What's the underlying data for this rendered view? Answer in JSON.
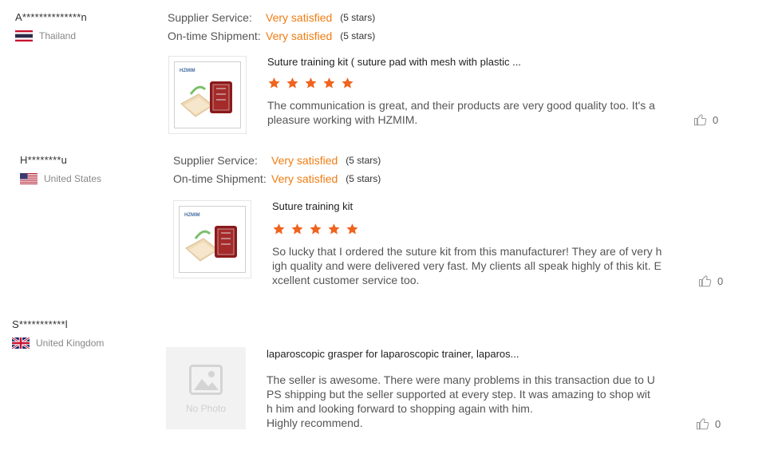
{
  "reviews": [
    {
      "buyer": "A**************n",
      "country": "Thailand",
      "supplier_label": "Supplier Service:",
      "supplier_value": "Very satisfied",
      "supplier_stars": "(5 stars)",
      "shipment_label": "On-time Shipment:",
      "shipment_value": "Very satisfied",
      "shipment_stars": "(5 stars)",
      "thumb_brand": "HZMIM",
      "product": "Suture training kit ( suture pad with mesh with plastic ...",
      "rating": 5,
      "text_lines": [
        "The communication is great, and their products are very good quality too. It's a",
        "pleasure working with HZMIM."
      ],
      "likes": "0"
    },
    {
      "buyer": "H********u",
      "country": "United States",
      "supplier_label": "Supplier Service:",
      "supplier_value": "Very satisfied",
      "supplier_stars": "(5 stars)",
      "shipment_label": "On-time Shipment:",
      "shipment_value": "Very satisfied",
      "shipment_stars": "(5 stars)",
      "thumb_brand": "HZMIM",
      "product": "Suture training kit",
      "rating": 5,
      "text_lines": [
        "So lucky that I ordered the suture kit from this manufacturer! They are of very h",
        "igh quality and were delivered very fast. My clients all speak highly of this kit. E",
        "xcellent customer service too."
      ],
      "likes": "0"
    },
    {
      "buyer": "S***********l",
      "country": "United Kingdom",
      "no_photo_label": "No Photo",
      "product": "laparoscopic grasper for laparoscopic trainer, laparos...",
      "text_lines": [
        "The seller is awesome. There were many problems in this transaction due to U",
        "PS shipping but the seller supported at every step. It was amazing to shop wit",
        "h him and looking forward to shopping again with him.",
        "Highly recommend."
      ],
      "likes": "0"
    }
  ],
  "colors": {
    "accent": "#f07c12",
    "star": "#f0641e"
  }
}
